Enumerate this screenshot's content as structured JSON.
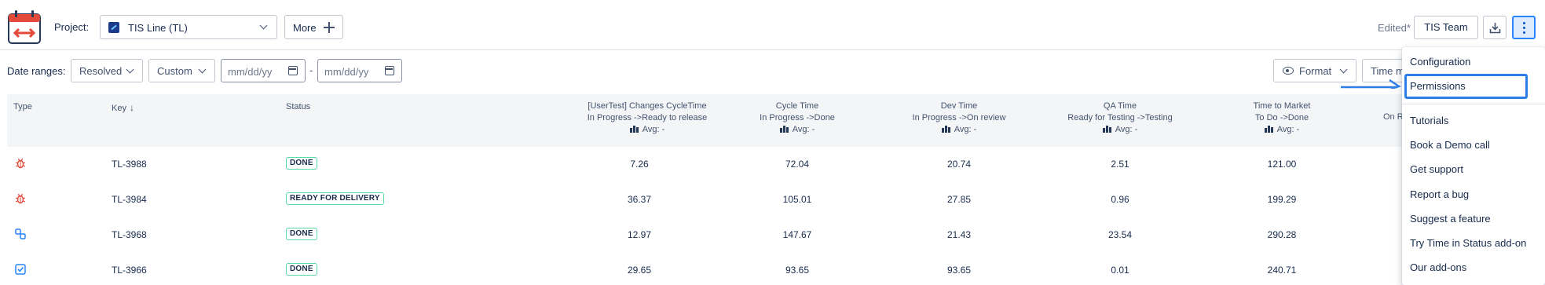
{
  "header": {
    "project_label": "Project:",
    "project_name": "TIS Line (TL)",
    "more_label": "More",
    "edited_label": "Edited*",
    "team_label": "TIS Team"
  },
  "filters": {
    "date_ranges_label": "Date ranges:",
    "resolved_label": "Resolved",
    "custom_label": "Custom",
    "date_from_placeholder": "mm/dd/yy",
    "date_to_placeholder": "mm/dd/yy",
    "separator": "-",
    "format_label": "Format",
    "time_label": "Time m"
  },
  "table": {
    "headers": {
      "type": "Type",
      "key": "Key",
      "key_sort": "↓",
      "status": "Status",
      "c1_line1": "[UserTest] Changes CycleTime",
      "c1_line2": "In Progress ->Ready to release",
      "c2_line1": "Cycle Time",
      "c2_line2": "In Progress ->Done",
      "c3_line1": "Dev Time",
      "c3_line2": "In Progress ->On review",
      "c4_line1": "QA Time",
      "c4_line2": "Ready for Testing ->Testing",
      "c5_line1": "Time to Market",
      "c5_line2": "To Do ->Done",
      "c6_partial": "On R",
      "avg": "Avg: -"
    },
    "rows": [
      {
        "type_icon": "bug-icon",
        "key": "TL-3988",
        "status": "DONE",
        "c1": "7.26",
        "c2": "72.04",
        "c3": "20.74",
        "c4": "2.51",
        "c5": "121.00"
      },
      {
        "type_icon": "bug-icon",
        "key": "TL-3984",
        "status": "READY FOR DELIVERY",
        "c1": "36.37",
        "c2": "105.01",
        "c3": "27.85",
        "c4": "0.96",
        "c5": "199.29"
      },
      {
        "type_icon": "subtask-icon",
        "key": "TL-3968",
        "status": "DONE",
        "c1": "12.97",
        "c2": "147.67",
        "c3": "21.43",
        "c4": "23.54",
        "c5": "290.28"
      },
      {
        "type_icon": "task-icon",
        "key": "TL-3966",
        "status": "DONE",
        "c1": "29.65",
        "c2": "93.65",
        "c3": "93.65",
        "c4": "0.01",
        "c5": "240.71"
      }
    ]
  },
  "menu": {
    "items": [
      "Configuration",
      "Permissions",
      "Tutorials",
      "Book a Demo call",
      "Get support",
      "Report a bug",
      "Suggest a feature",
      "Try Time in Status add-on",
      "Our add-ons"
    ],
    "highlighted": "Permissions"
  },
  "colors": {
    "accent": "#0052cc",
    "annotation": "#2f7ee8",
    "bug": "#e5493a",
    "lozenge_border": "#57d9a3"
  }
}
